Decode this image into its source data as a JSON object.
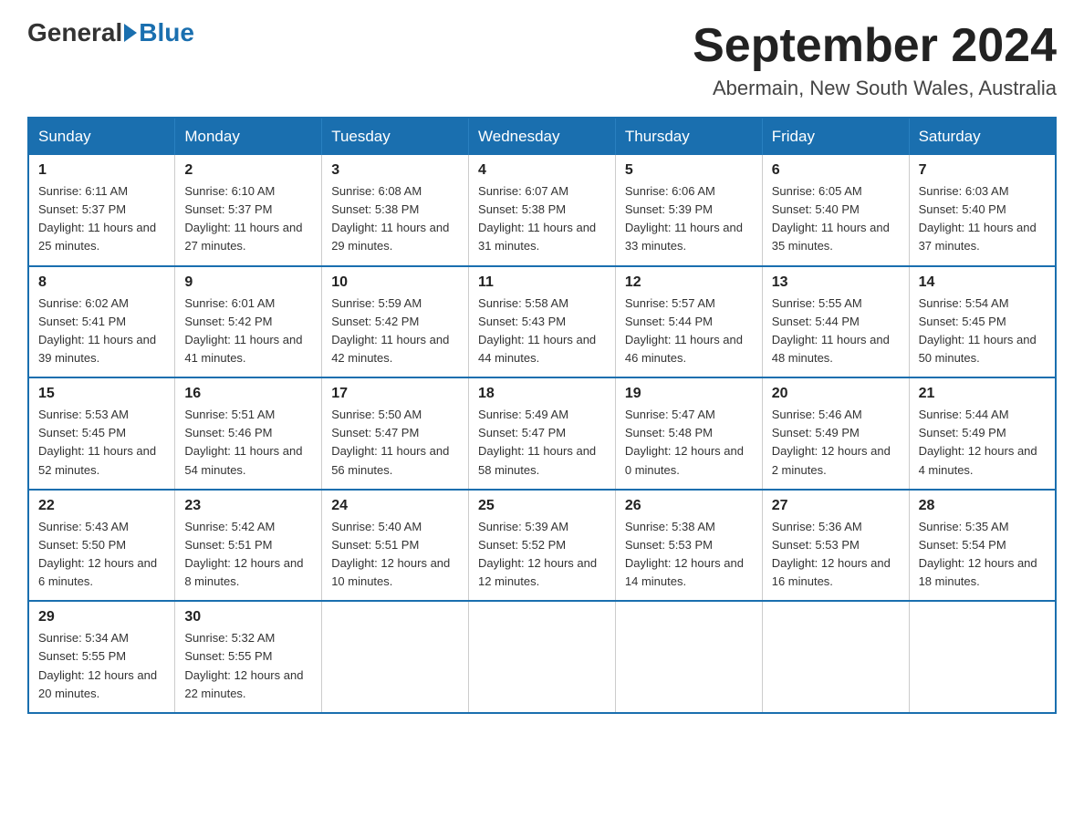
{
  "header": {
    "logo_general": "General",
    "logo_blue": "Blue",
    "month_year": "September 2024",
    "location": "Abermain, New South Wales, Australia"
  },
  "days_of_week": [
    "Sunday",
    "Monday",
    "Tuesday",
    "Wednesday",
    "Thursday",
    "Friday",
    "Saturday"
  ],
  "weeks": [
    [
      {
        "num": "1",
        "sunrise": "6:11 AM",
        "sunset": "5:37 PM",
        "daylight": "11 hours and 25 minutes."
      },
      {
        "num": "2",
        "sunrise": "6:10 AM",
        "sunset": "5:37 PM",
        "daylight": "11 hours and 27 minutes."
      },
      {
        "num": "3",
        "sunrise": "6:08 AM",
        "sunset": "5:38 PM",
        "daylight": "11 hours and 29 minutes."
      },
      {
        "num": "4",
        "sunrise": "6:07 AM",
        "sunset": "5:38 PM",
        "daylight": "11 hours and 31 minutes."
      },
      {
        "num": "5",
        "sunrise": "6:06 AM",
        "sunset": "5:39 PM",
        "daylight": "11 hours and 33 minutes."
      },
      {
        "num": "6",
        "sunrise": "6:05 AM",
        "sunset": "5:40 PM",
        "daylight": "11 hours and 35 minutes."
      },
      {
        "num": "7",
        "sunrise": "6:03 AM",
        "sunset": "5:40 PM",
        "daylight": "11 hours and 37 minutes."
      }
    ],
    [
      {
        "num": "8",
        "sunrise": "6:02 AM",
        "sunset": "5:41 PM",
        "daylight": "11 hours and 39 minutes."
      },
      {
        "num": "9",
        "sunrise": "6:01 AM",
        "sunset": "5:42 PM",
        "daylight": "11 hours and 41 minutes."
      },
      {
        "num": "10",
        "sunrise": "5:59 AM",
        "sunset": "5:42 PM",
        "daylight": "11 hours and 42 minutes."
      },
      {
        "num": "11",
        "sunrise": "5:58 AM",
        "sunset": "5:43 PM",
        "daylight": "11 hours and 44 minutes."
      },
      {
        "num": "12",
        "sunrise": "5:57 AM",
        "sunset": "5:44 PM",
        "daylight": "11 hours and 46 minutes."
      },
      {
        "num": "13",
        "sunrise": "5:55 AM",
        "sunset": "5:44 PM",
        "daylight": "11 hours and 48 minutes."
      },
      {
        "num": "14",
        "sunrise": "5:54 AM",
        "sunset": "5:45 PM",
        "daylight": "11 hours and 50 minutes."
      }
    ],
    [
      {
        "num": "15",
        "sunrise": "5:53 AM",
        "sunset": "5:45 PM",
        "daylight": "11 hours and 52 minutes."
      },
      {
        "num": "16",
        "sunrise": "5:51 AM",
        "sunset": "5:46 PM",
        "daylight": "11 hours and 54 minutes."
      },
      {
        "num": "17",
        "sunrise": "5:50 AM",
        "sunset": "5:47 PM",
        "daylight": "11 hours and 56 minutes."
      },
      {
        "num": "18",
        "sunrise": "5:49 AM",
        "sunset": "5:47 PM",
        "daylight": "11 hours and 58 minutes."
      },
      {
        "num": "19",
        "sunrise": "5:47 AM",
        "sunset": "5:48 PM",
        "daylight": "12 hours and 0 minutes."
      },
      {
        "num": "20",
        "sunrise": "5:46 AM",
        "sunset": "5:49 PM",
        "daylight": "12 hours and 2 minutes."
      },
      {
        "num": "21",
        "sunrise": "5:44 AM",
        "sunset": "5:49 PM",
        "daylight": "12 hours and 4 minutes."
      }
    ],
    [
      {
        "num": "22",
        "sunrise": "5:43 AM",
        "sunset": "5:50 PM",
        "daylight": "12 hours and 6 minutes."
      },
      {
        "num": "23",
        "sunrise": "5:42 AM",
        "sunset": "5:51 PM",
        "daylight": "12 hours and 8 minutes."
      },
      {
        "num": "24",
        "sunrise": "5:40 AM",
        "sunset": "5:51 PM",
        "daylight": "12 hours and 10 minutes."
      },
      {
        "num": "25",
        "sunrise": "5:39 AM",
        "sunset": "5:52 PM",
        "daylight": "12 hours and 12 minutes."
      },
      {
        "num": "26",
        "sunrise": "5:38 AM",
        "sunset": "5:53 PM",
        "daylight": "12 hours and 14 minutes."
      },
      {
        "num": "27",
        "sunrise": "5:36 AM",
        "sunset": "5:53 PM",
        "daylight": "12 hours and 16 minutes."
      },
      {
        "num": "28",
        "sunrise": "5:35 AM",
        "sunset": "5:54 PM",
        "daylight": "12 hours and 18 minutes."
      }
    ],
    [
      {
        "num": "29",
        "sunrise": "5:34 AM",
        "sunset": "5:55 PM",
        "daylight": "12 hours and 20 minutes."
      },
      {
        "num": "30",
        "sunrise": "5:32 AM",
        "sunset": "5:55 PM",
        "daylight": "12 hours and 22 minutes."
      },
      null,
      null,
      null,
      null,
      null
    ]
  ],
  "labels": {
    "sunrise_prefix": "Sunrise: ",
    "sunset_prefix": "Sunset: ",
    "daylight_prefix": "Daylight: "
  }
}
